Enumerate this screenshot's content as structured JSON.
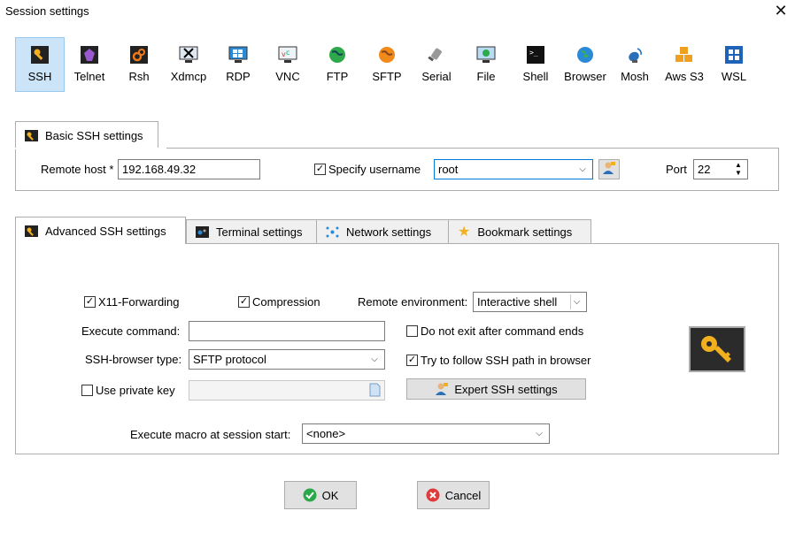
{
  "window": {
    "title": "Session settings",
    "close_icon": "close-icon"
  },
  "protocols": [
    {
      "label": "SSH",
      "icon": "ssh-key-icon",
      "selected": true
    },
    {
      "label": "Telnet",
      "icon": "telnet-icon"
    },
    {
      "label": "Rsh",
      "icon": "rsh-icon"
    },
    {
      "label": "Xdmcp",
      "icon": "xdmcp-icon"
    },
    {
      "label": "RDP",
      "icon": "rdp-icon"
    },
    {
      "label": "VNC",
      "icon": "vnc-icon"
    },
    {
      "label": "FTP",
      "icon": "ftp-icon"
    },
    {
      "label": "SFTP",
      "icon": "sftp-icon"
    },
    {
      "label": "Serial",
      "icon": "serial-icon"
    },
    {
      "label": "File",
      "icon": "file-icon"
    },
    {
      "label": "Shell",
      "icon": "shell-icon"
    },
    {
      "label": "Browser",
      "icon": "browser-icon"
    },
    {
      "label": "Mosh",
      "icon": "mosh-icon"
    },
    {
      "label": "Aws S3",
      "icon": "aws-s3-icon"
    },
    {
      "label": "WSL",
      "icon": "wsl-icon"
    }
  ],
  "basic": {
    "tab_label": "Basic SSH settings",
    "remote_host_label": "Remote host *",
    "remote_host_value": "192.168.49.32",
    "specify_username_label": "Specify username",
    "specify_username_checked": true,
    "username_value": "root",
    "port_label": "Port",
    "port_value": "22"
  },
  "tabs": [
    {
      "label": "Advanced SSH settings",
      "icon": "key-icon",
      "active": true
    },
    {
      "label": "Terminal settings",
      "icon": "terminal-icon"
    },
    {
      "label": "Network settings",
      "icon": "network-icon"
    },
    {
      "label": "Bookmark settings",
      "icon": "star-icon"
    }
  ],
  "advanced": {
    "x11_label": "X11-Forwarding",
    "x11_checked": true,
    "compression_label": "Compression",
    "compression_checked": true,
    "remote_env_label": "Remote environment:",
    "remote_env_value": "Interactive shell",
    "exec_cmd_label": "Execute command:",
    "exec_cmd_value": "",
    "no_exit_label": "Do not exit after command ends",
    "no_exit_checked": false,
    "browser_type_label": "SSH-browser type:",
    "browser_type_value": "SFTP protocol",
    "follow_path_label": "Try to follow SSH path in browser",
    "follow_path_checked": true,
    "private_key_label": "Use private key",
    "private_key_checked": false,
    "private_key_value": "",
    "expert_button_label": "Expert SSH settings",
    "macro_label": "Execute macro at session start:",
    "macro_value": "<none>"
  },
  "buttons": {
    "ok_label": "OK",
    "cancel_label": "Cancel"
  },
  "colors": {
    "selected_bg": "#cce4f7",
    "selected_border": "#99c9ef",
    "key_gold": "#f2b01e",
    "ok_green": "#2aa84a",
    "cancel_red": "#e03b3b"
  }
}
